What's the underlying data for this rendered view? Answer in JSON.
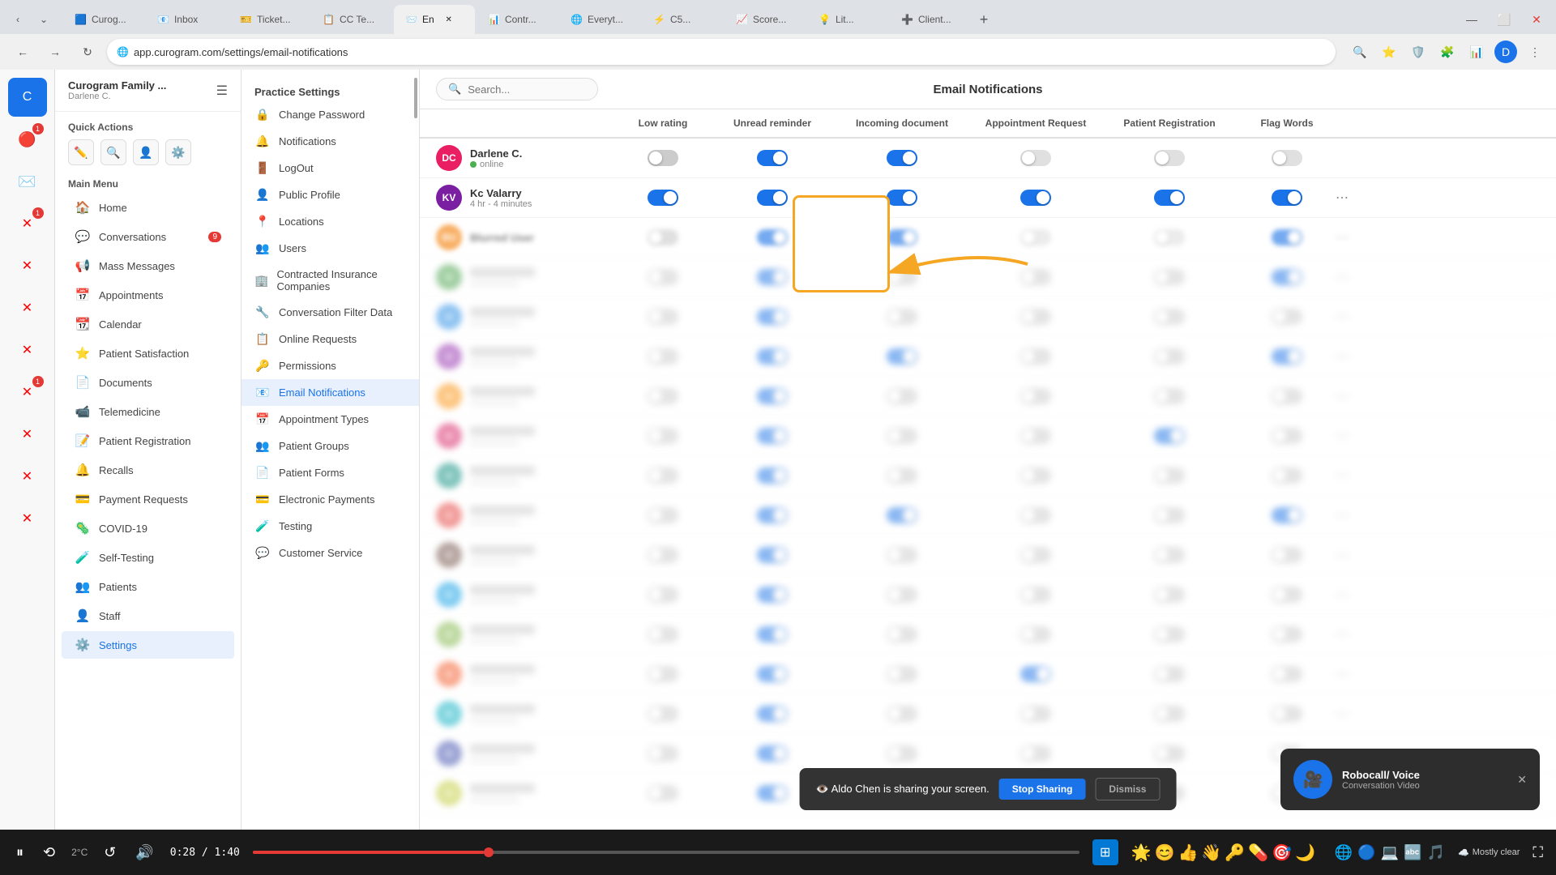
{
  "browser": {
    "tabs": [
      {
        "id": "t1",
        "icon": "🟦",
        "label": "Curog...",
        "active": false
      },
      {
        "id": "t2",
        "icon": "📧",
        "label": "Inbox",
        "active": false
      },
      {
        "id": "t3",
        "icon": "🎫",
        "label": "Ticket...",
        "active": false
      },
      {
        "id": "t4",
        "icon": "📋",
        "label": "CC Te...",
        "active": false
      },
      {
        "id": "t5",
        "icon": "📨",
        "label": "En",
        "active": true
      },
      {
        "id": "t6",
        "icon": "📊",
        "label": "Contr...",
        "active": false
      },
      {
        "id": "t7",
        "icon": "🌐",
        "label": "Everyt...",
        "active": false
      },
      {
        "id": "t8",
        "icon": "⚡",
        "label": "C5...",
        "active": false
      },
      {
        "id": "t9",
        "icon": "📈",
        "label": "Score...",
        "active": false
      },
      {
        "id": "t10",
        "icon": "💡",
        "label": "Lit...",
        "active": false
      },
      {
        "id": "t11",
        "icon": "➕",
        "label": "Client...",
        "active": false
      }
    ],
    "url": "app.curogram.com/settings/email-notifications"
  },
  "nav": {
    "org_name": "Curogram Family ...",
    "org_sub": "Darlene C.",
    "quick_actions": [
      "✏️",
      "🔍",
      "👤",
      "⚙️"
    ],
    "main_menu_label": "Main Menu",
    "items": [
      {
        "icon": "🏠",
        "label": "Home",
        "active": false,
        "badge": null
      },
      {
        "icon": "💬",
        "label": "Conversations",
        "active": false,
        "badge": "9"
      },
      {
        "icon": "📢",
        "label": "Mass Messages",
        "active": false,
        "badge": null
      },
      {
        "icon": "📅",
        "label": "Appointments",
        "active": false,
        "badge": null
      },
      {
        "icon": "📆",
        "label": "Calendar",
        "active": false,
        "badge": null
      },
      {
        "icon": "⭐",
        "label": "Patient Satisfaction",
        "active": false,
        "badge": null
      },
      {
        "icon": "📄",
        "label": "Documents",
        "active": false,
        "badge": null
      },
      {
        "icon": "📹",
        "label": "Telemedicine",
        "active": false,
        "badge": null
      },
      {
        "icon": "📝",
        "label": "Patient Registration",
        "active": false,
        "badge": null
      },
      {
        "icon": "🔔",
        "label": "Recalls",
        "active": false,
        "badge": null
      },
      {
        "icon": "💳",
        "label": "Payment Requests",
        "active": false,
        "badge": null
      },
      {
        "icon": "🦠",
        "label": "COVID-19",
        "active": false,
        "badge": null
      },
      {
        "icon": "🧪",
        "label": "Self-Testing",
        "active": false,
        "badge": null
      },
      {
        "icon": "👥",
        "label": "Patients",
        "active": false,
        "badge": null
      },
      {
        "icon": "👤",
        "label": "Staff",
        "active": false,
        "badge": null
      },
      {
        "icon": "⚙️",
        "label": "Settings",
        "active": true,
        "badge": null
      }
    ]
  },
  "settings_sidebar": {
    "title": "Practice Settings",
    "items": [
      {
        "icon": "🔒",
        "label": "Change Password"
      },
      {
        "icon": "🔔",
        "label": "Notifications"
      },
      {
        "icon": "🚪",
        "label": "LogOut"
      },
      {
        "icon": "👤",
        "label": "Public Profile"
      },
      {
        "icon": "📍",
        "label": "Locations"
      },
      {
        "icon": "👥",
        "label": "Users"
      },
      {
        "icon": "🏢",
        "label": "Contracted Insurance Companies"
      },
      {
        "icon": "🔧",
        "label": "Conversation Filter Data"
      },
      {
        "icon": "📋",
        "label": "Online Requests"
      },
      {
        "icon": "🔑",
        "label": "Permissions"
      },
      {
        "icon": "📧",
        "label": "Email Notifications",
        "active": true
      },
      {
        "icon": "📅",
        "label": "Appointment Types"
      },
      {
        "icon": "👥",
        "label": "Patient Groups"
      },
      {
        "icon": "📄",
        "label": "Patient Forms"
      },
      {
        "icon": "💳",
        "label": "Electronic Payments"
      },
      {
        "icon": "🧪",
        "label": "Testing"
      },
      {
        "icon": "💬",
        "label": "Customer Service"
      }
    ]
  },
  "content": {
    "title": "Email Notifications",
    "search_placeholder": "Search...",
    "columns": [
      "",
      "Low rating",
      "Unread reminder",
      "Incoming document",
      "Appointment Request",
      "Patient Registration",
      "Flag Words",
      ""
    ],
    "users": [
      {
        "name": "Darlene C.",
        "status": "online",
        "avatar_color": "#e91e63",
        "avatar_initials": "DC",
        "toggles": {
          "low_rating": {
            "state": "off"
          },
          "unread_reminder": {
            "state": "on"
          },
          "incoming_doc": {
            "state": "on"
          },
          "appointment_req": {
            "state": "off"
          },
          "patient_reg": {
            "state": "off"
          },
          "flag_words": {
            "state": "off"
          }
        }
      },
      {
        "name": "Kc Valarry",
        "status": "4 hr - 4 minutes",
        "avatar_color": "#7b1fa2",
        "avatar_initials": "KV",
        "toggles": {
          "low_rating": {
            "state": "on"
          },
          "unread_reminder": {
            "state": "on"
          },
          "incoming_doc": {
            "state": "on"
          },
          "appointment_req": {
            "state": "on"
          },
          "patient_reg": {
            "state": "on"
          },
          "flag_words": {
            "state": "on"
          }
        },
        "more": true
      },
      {
        "name": "Blurred User 3",
        "status": "",
        "avatar_color": "#f57c00",
        "avatar_initials": "BU",
        "blurred": true,
        "toggles": {
          "low_rating": {
            "state": "off"
          },
          "unread_reminder": {
            "state": "on"
          },
          "incoming_doc": {
            "state": "off"
          },
          "appointment_req": {
            "state": "off"
          },
          "patient_reg": {
            "state": "off"
          },
          "flag_words": {
            "state": "on"
          }
        },
        "more": true
      }
    ],
    "blurred_rows": 14
  },
  "highlight": {
    "label": "Low rating"
  },
  "notification": {
    "message": "👁️ Aldo Chen is sharing your screen.",
    "btn_stop": "Stop Sharing",
    "btn_dismiss": "Dismiss"
  },
  "popup": {
    "title": "Robocall/ Voice",
    "subtitle": "Conversation Video",
    "close": "✕"
  },
  "video_controls": {
    "time_current": "0:28",
    "time_total": "1:40",
    "progress_pct": 28,
    "weather": "Mostly clear",
    "emojis": [
      "🌟",
      "😊",
      "👍",
      "👋",
      "🔑",
      "💊",
      "🎯",
      "🌙"
    ]
  }
}
